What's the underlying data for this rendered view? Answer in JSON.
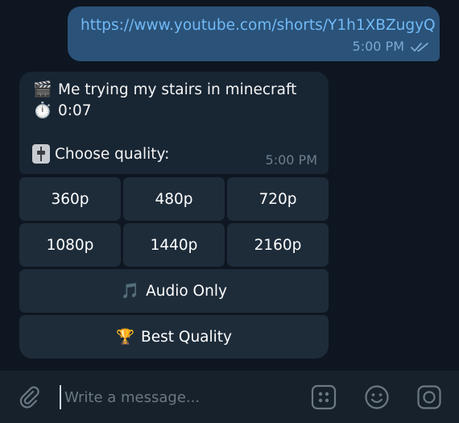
{
  "outgoing": {
    "text": "https://www.youtube.com/shorts/Y1h1XBZugyQ",
    "time": "5:00 PM"
  },
  "incoming": {
    "title_emoji": "🎬",
    "title": "Me trying my stairs in minecraft",
    "duration_emoji": "⏱️",
    "duration": "0:07",
    "prompt": "Choose quality:",
    "time": "5:00 PM"
  },
  "keyboard": {
    "row1": [
      "360p",
      "480p",
      "720p"
    ],
    "row2": [
      "1080p",
      "1440p",
      "2160p"
    ],
    "audio_emoji": "🎵",
    "audio": "Audio Only",
    "best_emoji": "🏆",
    "best": "Best Quality"
  },
  "composer": {
    "placeholder": "Write a message..."
  },
  "icons": [
    "paperclip-icon",
    "bot-commands-icon",
    "emoji-icon",
    "camera-icon",
    "read-ticks-icon",
    "slider-icon"
  ],
  "colors": {
    "background": "#0e1621",
    "outgoing_bubble": "#2b5278",
    "incoming_bubble": "#182533",
    "button": "#1e2c3a",
    "link": "#71baf7",
    "composer": "#17212b"
  }
}
